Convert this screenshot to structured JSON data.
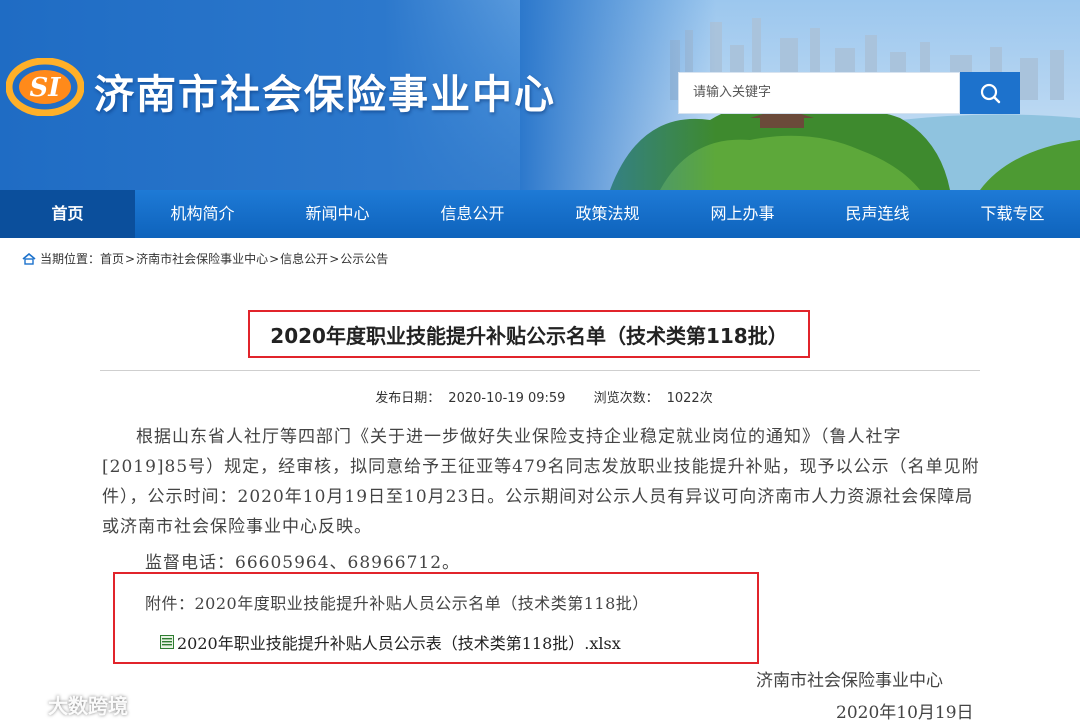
{
  "header": {
    "site_title": "济南市社会保险事业中心",
    "logo_text": "SI",
    "logo_icon": "si-logo-icon",
    "search": {
      "placeholder": "请输入关键字",
      "icon": "search-icon"
    }
  },
  "nav": {
    "items": [
      {
        "label": "首页",
        "active": true
      },
      {
        "label": "机构简介"
      },
      {
        "label": "新闻中心"
      },
      {
        "label": "信息公开"
      },
      {
        "label": "政策法规"
      },
      {
        "label": "网上办事"
      },
      {
        "label": "民声连线"
      },
      {
        "label": "下载专区"
      }
    ]
  },
  "breadcrumb": {
    "icon": "home-icon",
    "prefix": "当期位置：",
    "items": [
      "首页",
      "济南市社会保险事业中心",
      "信息公开",
      "公示公告"
    ],
    "separator": ">"
  },
  "article": {
    "title": "2020年度职业技能提升补贴公示名单（技术类第118批）",
    "publish_label": "发布日期：",
    "publish_date": "2020-10-19 09:59",
    "views_label": "浏览次数：",
    "views": "1022次",
    "body": "根据山东省人社厅等四部门《关于进一步做好失业保险支持企业稳定就业岗位的通知》（鲁人社字[2019]85号）规定，经审核，拟同意给予王征亚等479名同志发放职业技能提升补贴，现予以公示（名单见附件），公示时间：2020年10月19日至10月23日。公示期间对公示人员有异议可向济南市人力资源社会保障局或济南市社会保险事业中心反映。",
    "phone": "监督电话：66605964、68966712。",
    "attachment_label": "附件：2020年度职业技能提升补贴人员公示名单（技术类第118批）",
    "attachment_file": "2020年职业技能提升补贴人员公示表（技术类第118批）.xlsx",
    "attachment_icon": "excel-file-icon",
    "signature_org": "济南市社会保险事业中心",
    "signature_date": "2020年10月19日"
  },
  "watermark": {
    "text": "大数跨境",
    "icon": "watermark-logo-icon"
  },
  "colors": {
    "nav_bg": "#1567c2",
    "nav_active": "#0b4f9c",
    "highlight_border": "#e1242b",
    "search_button": "#1d72cc"
  }
}
